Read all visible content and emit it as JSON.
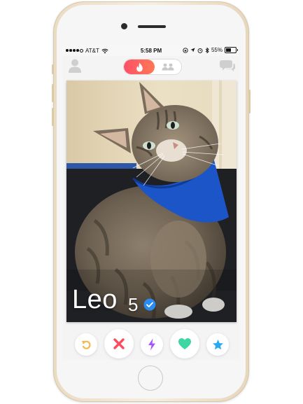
{
  "status_bar": {
    "carrier": "AT&T",
    "time": "5:58 PM",
    "battery_percent": "55%",
    "battery_level": 0.55,
    "signal_bars": 4,
    "icons": [
      "signal-dots-icon",
      "wifi-icon",
      "screen-lock-rotation-icon",
      "location-arrow-icon",
      "alarm-icon",
      "bluetooth-icon",
      "battery-icon"
    ]
  },
  "top_nav": {
    "left_icon": "profile-icon",
    "toggle": {
      "active": "flame-icon",
      "inactive": "groups-icon",
      "active_gradient": [
        "#fd5068",
        "#ff7854"
      ]
    },
    "right_icon": "messages-icon"
  },
  "profile_card": {
    "name": "Leo",
    "age": "5",
    "verified": true,
    "photo": "tabby-cat-with-blue-bandana"
  },
  "action_buttons": [
    {
      "name": "rewind",
      "icon": "rewind-icon",
      "color": "#f5b748"
    },
    {
      "name": "nope",
      "icon": "close-x-icon",
      "color": "#fd4b5e"
    },
    {
      "name": "boost",
      "icon": "lightning-bolt-icon",
      "color": "#a855f7"
    },
    {
      "name": "like",
      "icon": "heart-icon",
      "color": "#3ed6a2"
    },
    {
      "name": "super-like",
      "icon": "star-icon",
      "color": "#2aa9f3"
    }
  ],
  "colors": {
    "brand_gradient_start": "#fd5068",
    "brand_gradient_end": "#ff7854",
    "verified_blue": "#2b8cf0",
    "phone_gold": "#efe3cc"
  }
}
